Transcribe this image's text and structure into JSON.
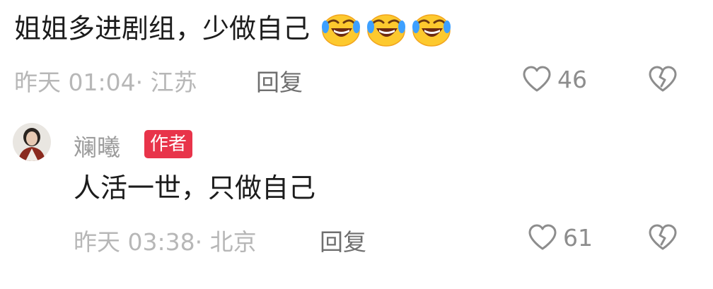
{
  "comment_1": {
    "text": "姐姐多进剧组，少做自己",
    "emojis": [
      "laughing-crying-emoji",
      "laughing-crying-emoji",
      "laughing-crying-emoji"
    ],
    "timestamp": "昨天 01:04",
    "location": "· 江苏",
    "reply_label": "回复",
    "like_count": "46"
  },
  "comment_2": {
    "author": "斓曦",
    "author_badge": "作者",
    "text": "人活一世，只做自己",
    "timestamp": "昨天 03:38",
    "location": "· 北京",
    "reply_label": "回复",
    "like_count": "61"
  },
  "colors": {
    "badge": "#e8344a",
    "meta_text": "#b7b7b7",
    "reply_text": "#6f6f6f",
    "body_text": "#1c1c1c"
  }
}
